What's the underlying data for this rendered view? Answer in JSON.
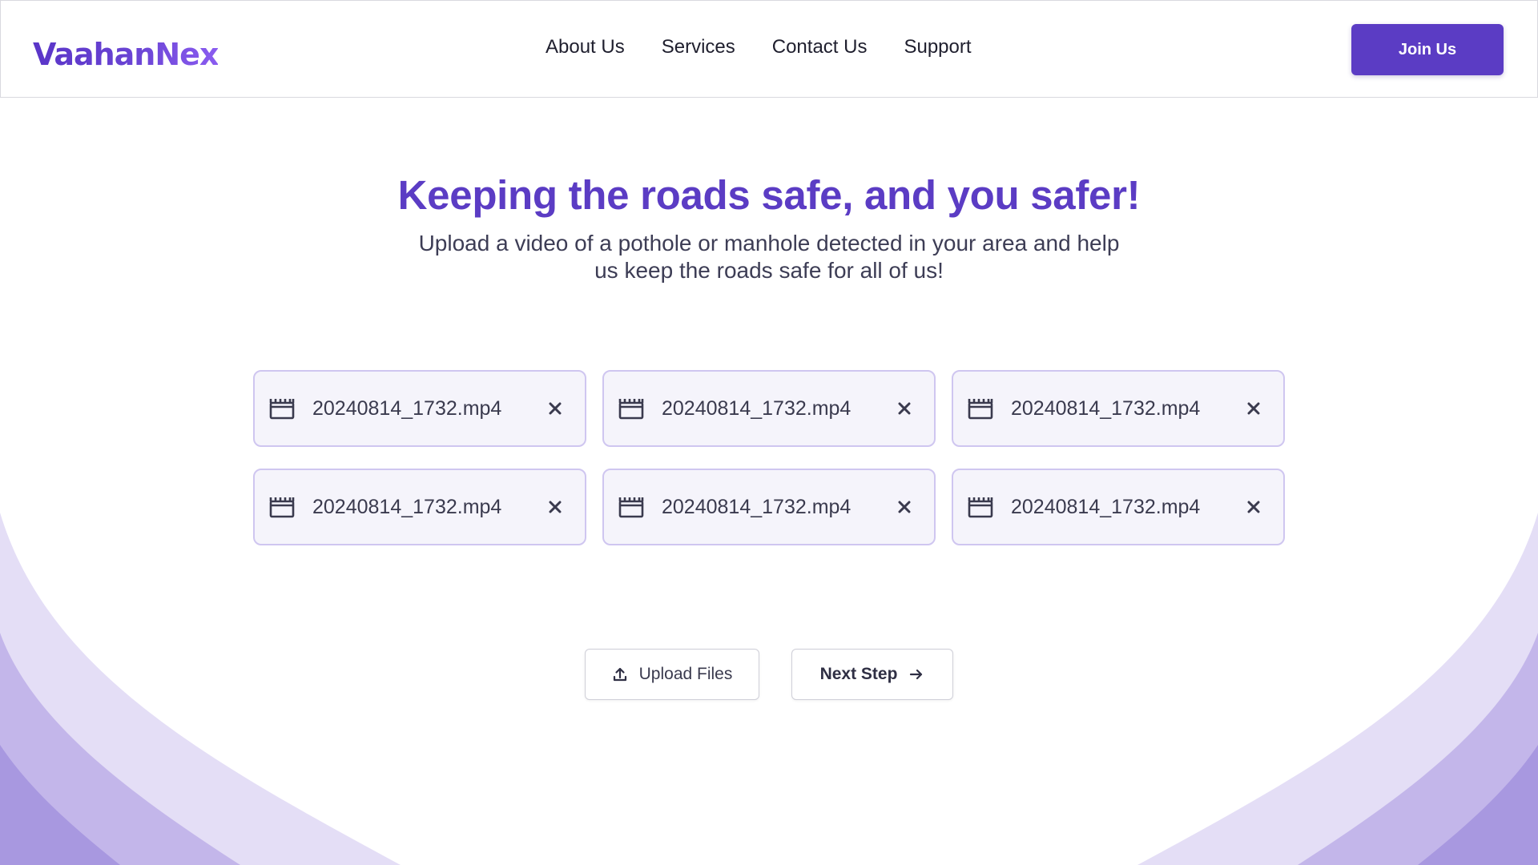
{
  "brand": {
    "logo_text": "VaahanNex"
  },
  "nav": {
    "items": [
      {
        "label": "About Us"
      },
      {
        "label": "Services"
      },
      {
        "label": "Contact Us"
      },
      {
        "label": "Support"
      }
    ],
    "join_label": "Join Us"
  },
  "hero": {
    "title": "Keeping the roads safe, and you safer!",
    "subtitle": "Upload a video of a pothole or manhole detected in your area and help us keep the roads safe for all of us!"
  },
  "files": [
    {
      "name": "20240814_1732.mp4",
      "icon": "video-clapper-icon"
    },
    {
      "name": "20240814_1732.mp4",
      "icon": "video-clapper-icon"
    },
    {
      "name": "20240814_1732.mp4",
      "icon": "video-clapper-icon"
    },
    {
      "name": "20240814_1732.mp4",
      "icon": "video-clapper-icon"
    },
    {
      "name": "20240814_1732.mp4",
      "icon": "video-clapper-icon"
    },
    {
      "name": "20240814_1732.mp4",
      "icon": "video-clapper-icon"
    }
  ],
  "actions": {
    "upload_label": "Upload Files",
    "upload_icon": "upload-icon",
    "next_label": "Next Step",
    "next_icon": "arrow-right-icon"
  },
  "colors": {
    "brand_purple": "#5b3cc4",
    "wave_light": "#e4def6",
    "wave_mid": "#c3b6ea",
    "wave_dark": "#a898e0"
  }
}
